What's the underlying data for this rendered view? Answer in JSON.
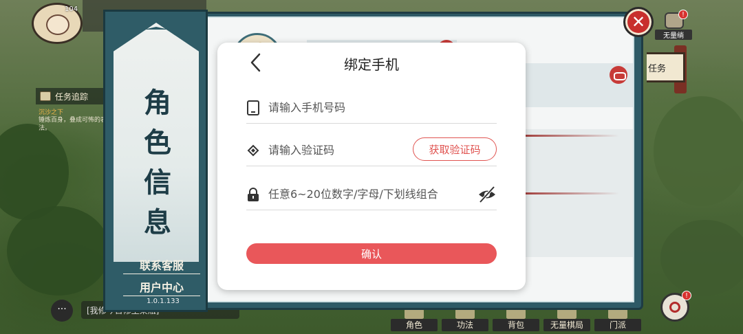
{
  "hud": {
    "level": "104",
    "quest_title": "任务追踪",
    "quest_name": "沉沙之下",
    "quest_desc": "锤炼百身，叠成可怖的表法。",
    "chat_placeholder": "[我修今日修至某瓶]",
    "no_scratch_label": "无量绱",
    "no_scratch_badge": "!",
    "task_label": "任务",
    "swirl_badge": "!",
    "bottom_menu": [
      "角色",
      "功法",
      "背包",
      "无量棋局",
      "门派"
    ]
  },
  "scroll": {
    "title_chars": [
      "角",
      "色",
      "信",
      "息"
    ],
    "customer_service": "联系客服",
    "user_center": "用户中心",
    "version": "1.0.1.133"
  },
  "dialog": {
    "title": "绑定手机",
    "phone_placeholder": "请输入手机号码",
    "code_placeholder": "请输入验证码",
    "get_code_label": "获取验证码",
    "password_placeholder": "任意6~20位数字/字母/下划线组合",
    "confirm_label": "确认"
  },
  "colors": {
    "accent_red": "#e9575a",
    "scroll_teal": "#2f5c67"
  }
}
